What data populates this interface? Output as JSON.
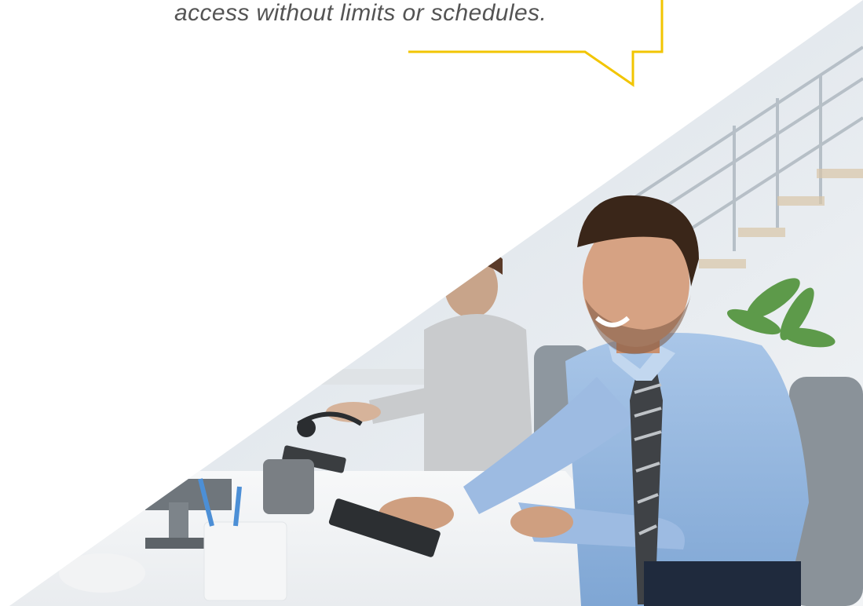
{
  "quote": {
    "text": "access without limits or schedules."
  },
  "photo": {
    "alt": "Smiling man in a light blue shirt and striped tie typing at a keyboard in a bright office, with a colleague in a grey jacket behind him",
    "accent_color": "#f2c500"
  }
}
